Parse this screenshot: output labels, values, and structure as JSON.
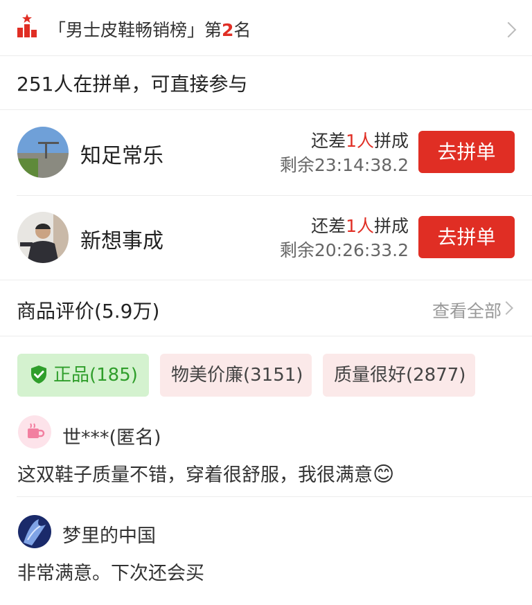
{
  "ranking": {
    "prefix": "「男士皮鞋畅销榜」第",
    "rank": "2",
    "suffix": "名"
  },
  "group_buy": {
    "header": "251人在拼单，可直接参与",
    "groups": [
      {
        "name": "知足常乐",
        "need_prefix": "还差",
        "need_count": "1人",
        "need_suffix": "拼成",
        "remaining": "剩余23:14:38.2",
        "button": "去拼单"
      },
      {
        "name": "新想事成",
        "need_prefix": "还差",
        "need_count": "1人",
        "need_suffix": "拼成",
        "remaining": "剩余20:26:33.2",
        "button": "去拼单"
      }
    ]
  },
  "reviews": {
    "title": "商品评价(5.9万)",
    "view_all": "查看全部",
    "tags": [
      {
        "label": "正品(185)",
        "icon": "shield-check-icon"
      },
      {
        "label": "物美价廉(3151)"
      },
      {
        "label": "质量很好(2877)"
      }
    ],
    "items": [
      {
        "user": "世***(匿名)",
        "text": "这双鞋子质量不错，穿着很舒服，我很满意",
        "emoji": "😊"
      },
      {
        "user": "梦里的中国",
        "text": "非常满意。下次还会买"
      }
    ]
  },
  "colors": {
    "accent": "#e02e24",
    "green_tag_bg": "#d4f2cf",
    "green_tag_text": "#2f9e2b",
    "pink_tag_bg": "#fbe9e9"
  }
}
